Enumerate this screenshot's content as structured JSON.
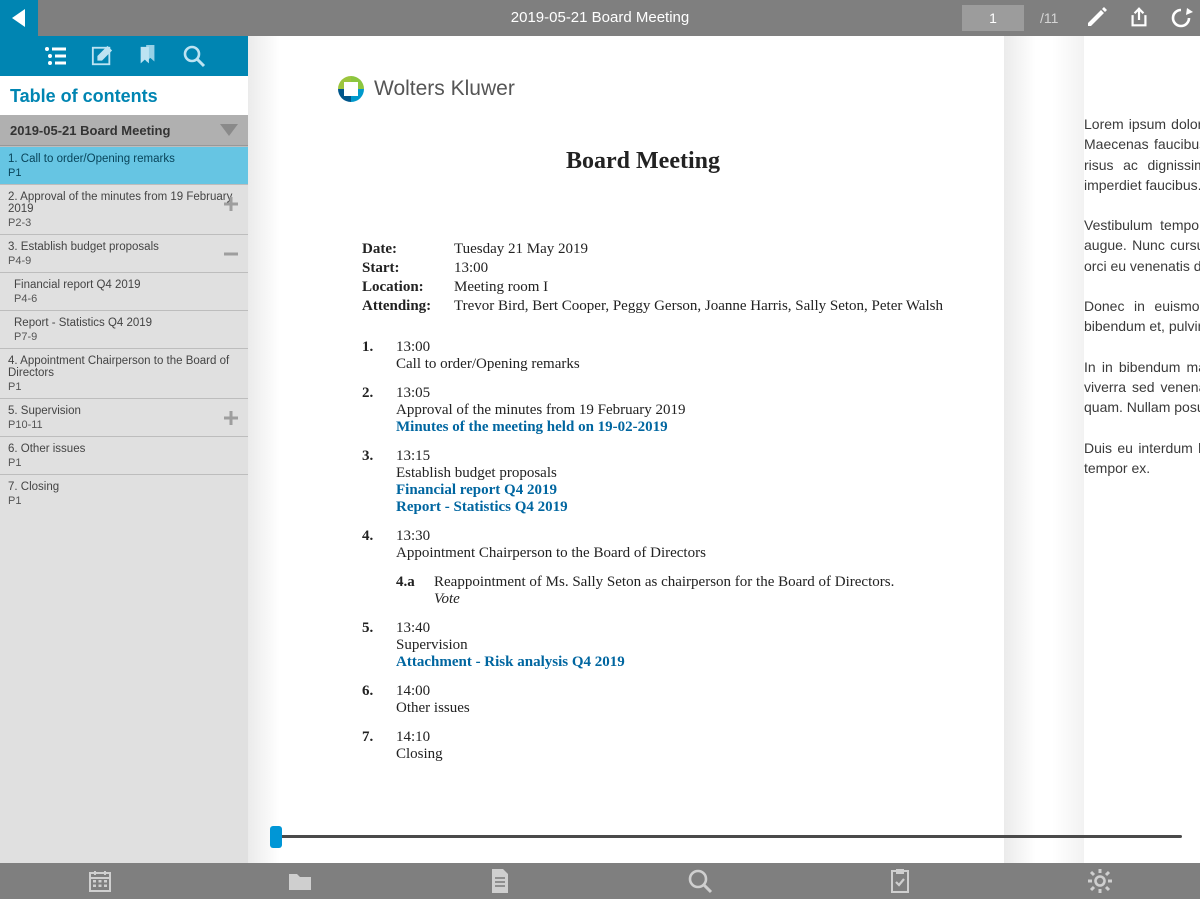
{
  "header": {
    "title": "2019-05-21 Board Meeting",
    "current_page": "1",
    "total_pages": "/11"
  },
  "sidebar": {
    "toc_label": "Table of contents",
    "doc_title": "2019-05-21 Board Meeting",
    "items": [
      {
        "title": "1. Call to order/Opening remarks",
        "page": "P1",
        "selected": true
      },
      {
        "title": "2. Approval of the minutes from 19 February 2019",
        "page": "P2-3",
        "expand": "plus"
      },
      {
        "title": "3. Establish budget proposals",
        "page": "P4-9",
        "expand": "minus"
      },
      {
        "title": "Financial report Q4 2019",
        "page": "P4-6",
        "sub": true
      },
      {
        "title": "Report - Statistics Q4 2019",
        "page": "P7-9",
        "sub": true
      },
      {
        "title": "4. Appointment Chairperson to the Board of Directors",
        "page": "P1"
      },
      {
        "title": "5. Supervision",
        "page": "P10-11",
        "expand": "plus"
      },
      {
        "title": "6. Other issues",
        "page": "P1"
      },
      {
        "title": "7. Closing",
        "page": "P1"
      }
    ]
  },
  "document": {
    "brand": "Wolters Kluwer",
    "title": "Board Meeting",
    "meta": {
      "date_label": "Date:",
      "date": "Tuesday 21 May 2019",
      "start_label": "Start:",
      "start": "13:00",
      "location_label": "Location:",
      "location": "Meeting room I",
      "attending_label": "Attending:",
      "attending": "Trevor Bird, Bert Cooper, Peggy Gerson, Joanne Harris, Sally Seton, Peter Walsh"
    },
    "agenda": [
      {
        "num": "1.",
        "time": "13:00",
        "title": "Call to order/Opening remarks"
      },
      {
        "num": "2.",
        "time": "13:05",
        "title": "Approval of the minutes from 19 February 2019",
        "links": [
          "Minutes of the meeting held on 19-02-2019"
        ]
      },
      {
        "num": "3.",
        "time": "13:15",
        "title": "Establish budget proposals",
        "links": [
          "Financial report Q4 2019",
          "Report - Statistics Q4 2019"
        ]
      },
      {
        "num": "4.",
        "time": "13:30",
        "title": "Appointment Chairperson to the Board of Directors",
        "sub": {
          "num": "4.a",
          "title": "Reappointment of Ms. Sally Seton as chairperson for the Board of Directors.",
          "vote": "Vote"
        }
      },
      {
        "num": "5.",
        "time": "13:40",
        "title": "Supervision",
        "links": [
          "Attachment - Risk analysis Q4 2019"
        ]
      },
      {
        "num": "6.",
        "time": "14:00",
        "title": "Other issues"
      },
      {
        "num": "7.",
        "time": "14:10",
        "title": "Closing"
      }
    ]
  },
  "page2": {
    "p1": "Lorem ipsum dolor sit amet, ultrices. Nunc pretium orci id arcu. Maecenas faucibus ligula, gravida sit amet risus mattis facilisis risus ac dignissim. Phasellus ex neque commodo posuere imperdiet faucibus.",
    "p2": "Vestibulum tempor vestibulum arcu dictum sodales lorem, at augue. Nunc cursus eros. Aenean euismod viverra. Vestibulum orci eu venenatis dictum, nisi eu faucibus tellus. Quisque id.",
    "p3": "Donec in euismod placerat id neque quis suscipit. Integer bibendum et, pulvinar interdum. Phasellus malesuada fames.",
    "p4": "In in bibendum massa, non mattis feugiat bibendum. Vivamus viverra sed venenatis nec nulla tincidunt feugiat fermentum ac quam. Nullam posuere sem aliquet, leo id viverra felis.",
    "p5": "Duis eu interdum luctus. Ut quis dolor ut, venenatis ac suscipit tempor ex."
  }
}
